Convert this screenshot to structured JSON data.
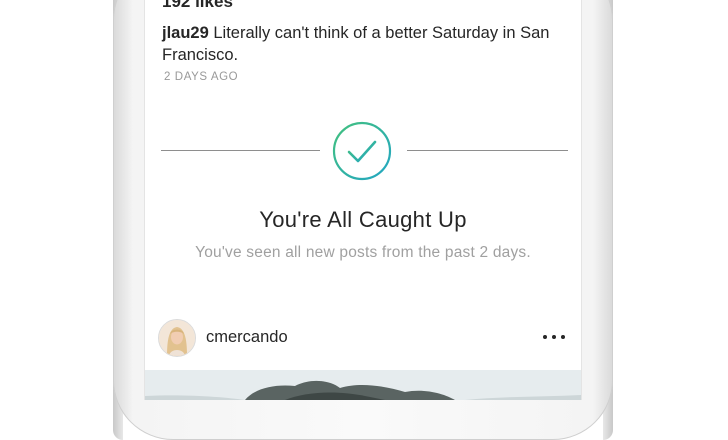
{
  "previous_post": {
    "likes": "192 likes",
    "caption_user": "jlau29",
    "caption_text": " Literally can't think of a better Saturday in San Francisco.",
    "timestamp": "2 DAYS AGO"
  },
  "caught_up": {
    "icon": "checkmark-circle-icon",
    "title": "You're All Caught Up",
    "subtitle": "You've seen all new posts from the past 2 days.",
    "gradient_colors": [
      "#3bbf8c",
      "#2aa9b8"
    ]
  },
  "next_post": {
    "username": "cmercando",
    "more_icon": "more-options-icon"
  }
}
